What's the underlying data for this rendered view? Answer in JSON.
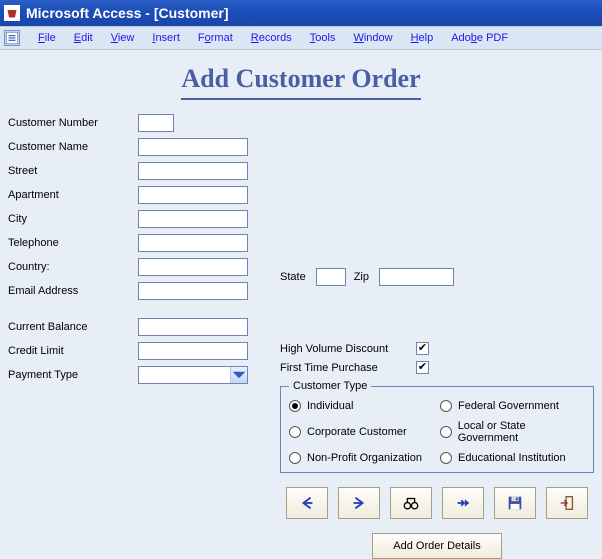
{
  "window": {
    "title": "Microsoft Access - [Customer]"
  },
  "menu": {
    "items": [
      "File",
      "Edit",
      "View",
      "Insert",
      "Format",
      "Records",
      "Tools",
      "Window",
      "Help",
      "Adobe PDF"
    ]
  },
  "heading": "Add Customer Order",
  "fields": {
    "customer_number_label": "Customer Number",
    "customer_number": "",
    "customer_name_label": "Customer Name",
    "customer_name": "",
    "street_label": "Street",
    "street": "",
    "apartment_label": "Apartment",
    "apartment": "",
    "city_label": "City",
    "city": "",
    "state_label": "State",
    "state": "",
    "zip_label": "Zip",
    "zip": "",
    "telephone_label": "Telephone",
    "telephone": "",
    "country_label": "Country:",
    "country": "",
    "email_label": "Email Address",
    "email": "",
    "current_balance_label": "Current Balance",
    "current_balance": "",
    "credit_limit_label": "Credit Limit",
    "credit_limit": "",
    "payment_type_label": "Payment Type",
    "payment_type": ""
  },
  "checks": {
    "high_volume_label": "High Volume Discount",
    "high_volume_checked": "✔",
    "first_time_label": "First Time Purchase",
    "first_time_checked": "✔"
  },
  "group": {
    "legend": "Customer Type",
    "options": [
      "Individual",
      "Federal Government",
      "Corporate Customer",
      "Local or State Government",
      "Non-Profit Organization",
      "Educational Institution"
    ],
    "selected_index": 0
  },
  "buttons": {
    "add_order_details": "Add Order Details"
  },
  "colors": {
    "titlebar": "#1b4db8",
    "accent": "#4b5fa6"
  }
}
